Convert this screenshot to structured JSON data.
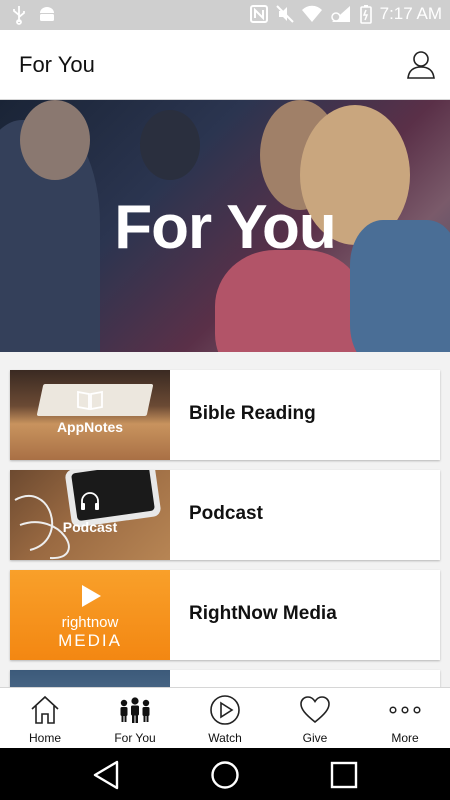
{
  "status_bar": {
    "time": "7:17 AM",
    "icons": [
      "usb-icon",
      "android-icon",
      "nfc-icon",
      "mute-icon",
      "wifi-icon",
      "signal-icon",
      "battery-icon"
    ]
  },
  "header": {
    "title": "For You",
    "profile_icon": "person-icon"
  },
  "hero": {
    "title": "For You"
  },
  "items": [
    {
      "label": "Bible Reading",
      "thumb_text": "AppNotes",
      "icon": "book-icon"
    },
    {
      "label": "Podcast",
      "thumb_text": "Podcast",
      "icon": "headphones-icon"
    },
    {
      "label": "RightNow Media",
      "thumb_text_top": "rightnow",
      "thumb_text_bottom": "MEDIA",
      "icon": "play-icon",
      "accent": "#f7941d"
    }
  ],
  "tabs": [
    {
      "label": "Home",
      "icon": "home-icon"
    },
    {
      "label": "For You",
      "icon": "people-icon",
      "active": true
    },
    {
      "label": "Watch",
      "icon": "play-circle-icon"
    },
    {
      "label": "Give",
      "icon": "heart-icon"
    },
    {
      "label": "More",
      "icon": "more-dots-icon"
    }
  ],
  "nav": [
    "back-icon",
    "home-circle-icon",
    "recents-icon"
  ]
}
